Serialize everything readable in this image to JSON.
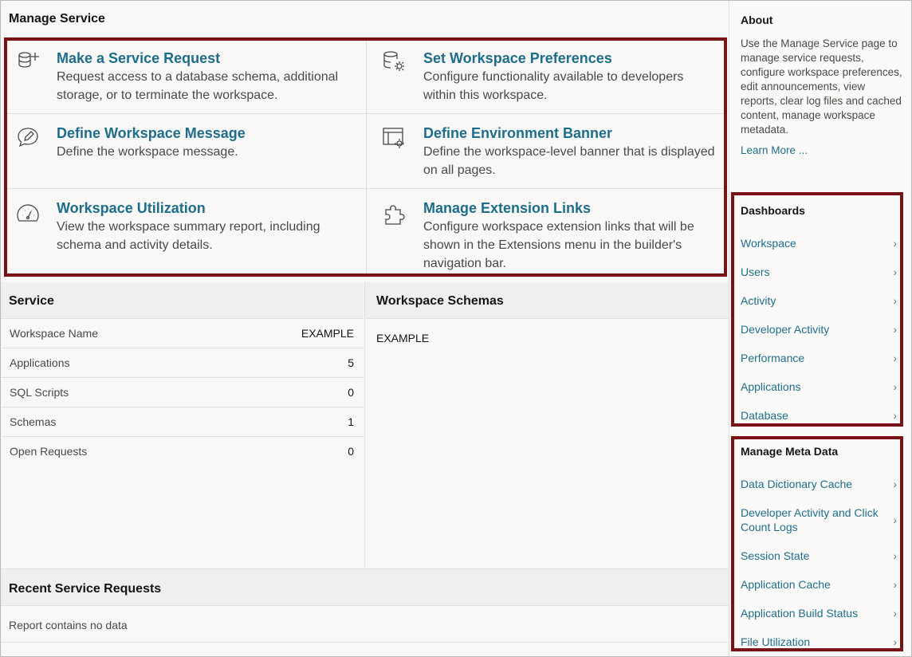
{
  "manage_service": {
    "title": "Manage Service",
    "cards": [
      {
        "title": "Make a Service Request",
        "desc": "Request access to a database schema, additional storage, or to terminate the workspace.",
        "icon": "database-add-icon"
      },
      {
        "title": "Set Workspace Preferences",
        "desc": "Configure functionality available to developers within this workspace.",
        "icon": "database-settings-icon"
      },
      {
        "title": "Define Workspace Message",
        "desc": "Define the workspace message.",
        "icon": "message-edit-icon"
      },
      {
        "title": "Define Environment Banner",
        "desc": "Define the workspace-level banner that is displayed on all pages.",
        "icon": "banner-settings-icon"
      },
      {
        "title": "Workspace Utilization",
        "desc": "View the workspace summary report, including schema and activity details.",
        "icon": "gauge-icon"
      },
      {
        "title": "Manage Extension Links",
        "desc": "Configure workspace extension links that will be shown in the Extensions menu in the builder's navigation bar.",
        "icon": "puzzle-icon"
      }
    ]
  },
  "service": {
    "title": "Service",
    "rows": [
      {
        "k": "Workspace Name",
        "v": "EXAMPLE"
      },
      {
        "k": "Applications",
        "v": "5"
      },
      {
        "k": "SQL Scripts",
        "v": "0"
      },
      {
        "k": "Schemas",
        "v": "1"
      },
      {
        "k": "Open Requests",
        "v": "0"
      }
    ]
  },
  "schemas": {
    "title": "Workspace Schemas",
    "value": "EXAMPLE"
  },
  "recent": {
    "title": "Recent Service Requests",
    "empty": "Report contains no data"
  },
  "about": {
    "title": "About",
    "text": "Use the Manage Service page to manage service requests, configure workspace preferences, edit announcements, view reports, clear log files and cached content, manage workspace metadata.",
    "learn_more": "Learn More ..."
  },
  "dashboards": {
    "title": "Dashboards",
    "items": [
      "Workspace",
      "Users",
      "Activity",
      "Developer Activity",
      "Performance",
      "Applications",
      "Database"
    ]
  },
  "meta": {
    "title": "Manage Meta Data",
    "items": [
      "Data Dictionary Cache",
      "Developer Activity and Click Count Logs",
      "Session State",
      "Application Cache",
      "Application Build Status",
      "File Utilization"
    ]
  },
  "colors": {
    "link": "#1d6d8c",
    "highlight_outline": "#7a1215",
    "region_header": "#f1efed"
  }
}
